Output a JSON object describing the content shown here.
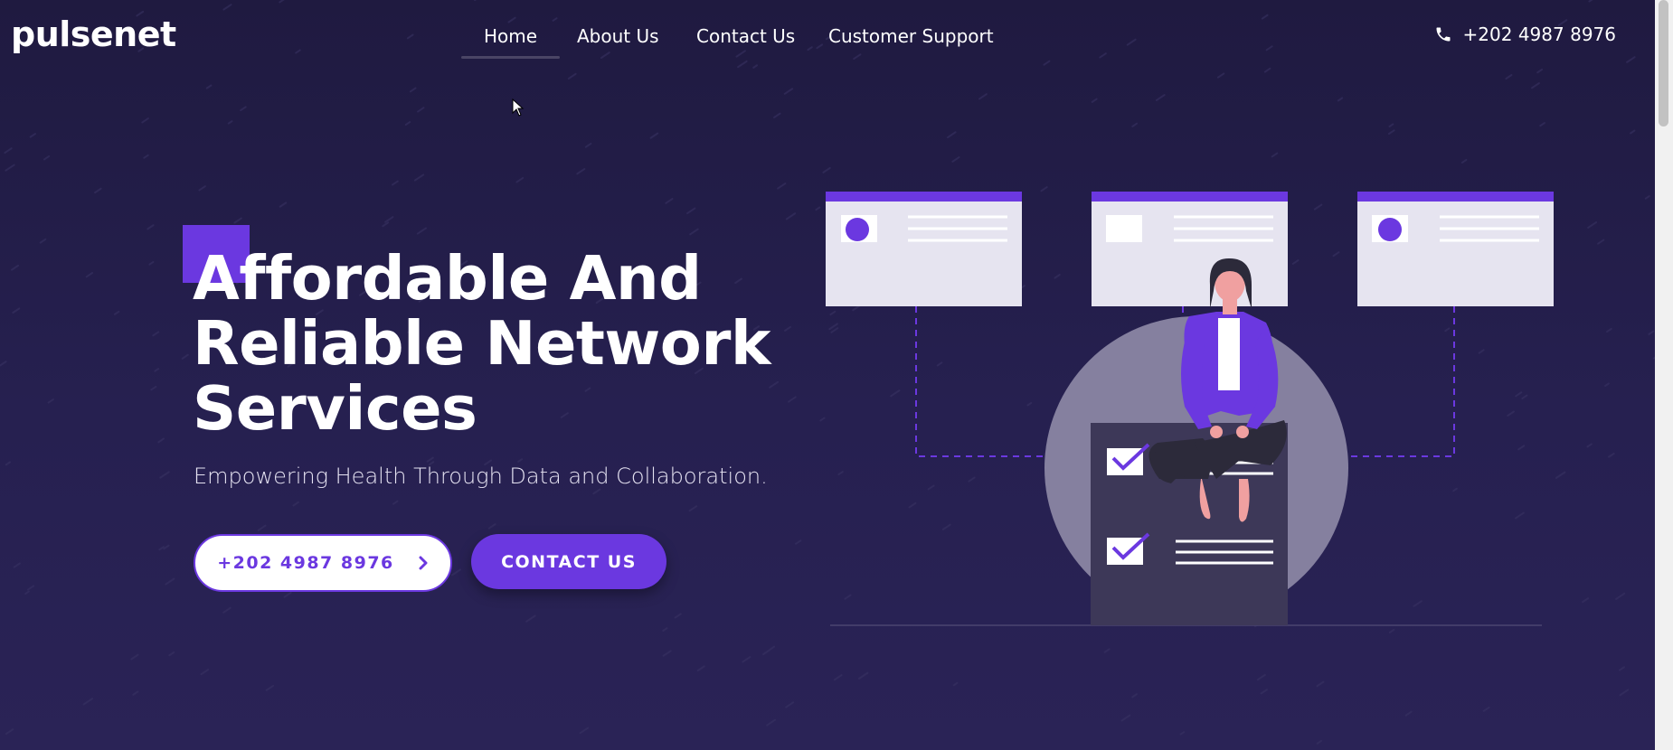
{
  "brand": {
    "logo": "pulsenet"
  },
  "nav": {
    "items": [
      {
        "label": "Home",
        "active": true
      },
      {
        "label": "About Us",
        "active": false
      },
      {
        "label": "Contact Us",
        "active": false
      },
      {
        "label": "Customer Support",
        "active": false
      }
    ]
  },
  "header": {
    "phone": "+202 4987 8976",
    "phone_icon": "phone-icon"
  },
  "hero": {
    "title": "Affordable And Reliable Network Services",
    "subtitle": "Empowering Health Through Data and Collaboration.",
    "phone_button": "+202 4987 8976",
    "contact_button": "CONTACT US"
  },
  "colors": {
    "background": "#231d47",
    "accent": "#6b38e0",
    "card": "#e6e4f0",
    "text": "#ffffff"
  }
}
